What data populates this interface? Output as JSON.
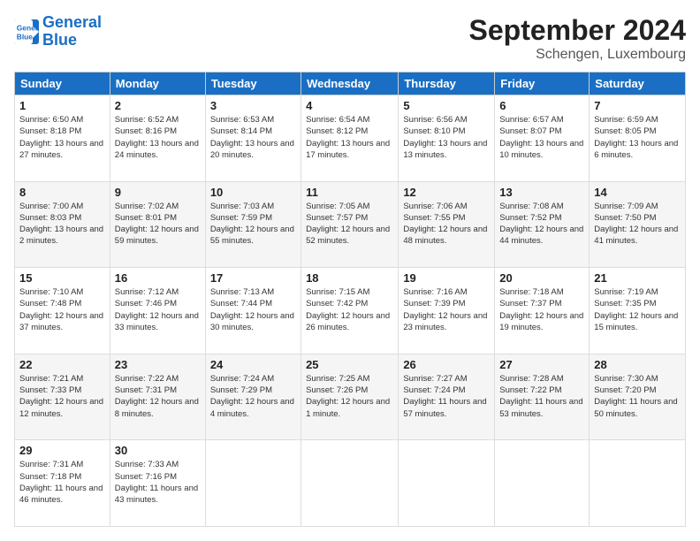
{
  "logo": {
    "line1": "General",
    "line2": "Blue"
  },
  "title": "September 2024",
  "location": "Schengen, Luxembourg",
  "days_header": [
    "Sunday",
    "Monday",
    "Tuesday",
    "Wednesday",
    "Thursday",
    "Friday",
    "Saturday"
  ],
  "weeks": [
    [
      {
        "day": "1",
        "sunrise": "6:50 AM",
        "sunset": "8:18 PM",
        "daylight": "13 hours and 27 minutes."
      },
      {
        "day": "2",
        "sunrise": "6:52 AM",
        "sunset": "8:16 PM",
        "daylight": "13 hours and 24 minutes."
      },
      {
        "day": "3",
        "sunrise": "6:53 AM",
        "sunset": "8:14 PM",
        "daylight": "13 hours and 20 minutes."
      },
      {
        "day": "4",
        "sunrise": "6:54 AM",
        "sunset": "8:12 PM",
        "daylight": "13 hours and 17 minutes."
      },
      {
        "day": "5",
        "sunrise": "6:56 AM",
        "sunset": "8:10 PM",
        "daylight": "13 hours and 13 minutes."
      },
      {
        "day": "6",
        "sunrise": "6:57 AM",
        "sunset": "8:07 PM",
        "daylight": "13 hours and 10 minutes."
      },
      {
        "day": "7",
        "sunrise": "6:59 AM",
        "sunset": "8:05 PM",
        "daylight": "13 hours and 6 minutes."
      }
    ],
    [
      {
        "day": "8",
        "sunrise": "7:00 AM",
        "sunset": "8:03 PM",
        "daylight": "13 hours and 2 minutes."
      },
      {
        "day": "9",
        "sunrise": "7:02 AM",
        "sunset": "8:01 PM",
        "daylight": "12 hours and 59 minutes."
      },
      {
        "day": "10",
        "sunrise": "7:03 AM",
        "sunset": "7:59 PM",
        "daylight": "12 hours and 55 minutes."
      },
      {
        "day": "11",
        "sunrise": "7:05 AM",
        "sunset": "7:57 PM",
        "daylight": "12 hours and 52 minutes."
      },
      {
        "day": "12",
        "sunrise": "7:06 AM",
        "sunset": "7:55 PM",
        "daylight": "12 hours and 48 minutes."
      },
      {
        "day": "13",
        "sunrise": "7:08 AM",
        "sunset": "7:52 PM",
        "daylight": "12 hours and 44 minutes."
      },
      {
        "day": "14",
        "sunrise": "7:09 AM",
        "sunset": "7:50 PM",
        "daylight": "12 hours and 41 minutes."
      }
    ],
    [
      {
        "day": "15",
        "sunrise": "7:10 AM",
        "sunset": "7:48 PM",
        "daylight": "12 hours and 37 minutes."
      },
      {
        "day": "16",
        "sunrise": "7:12 AM",
        "sunset": "7:46 PM",
        "daylight": "12 hours and 33 minutes."
      },
      {
        "day": "17",
        "sunrise": "7:13 AM",
        "sunset": "7:44 PM",
        "daylight": "12 hours and 30 minutes."
      },
      {
        "day": "18",
        "sunrise": "7:15 AM",
        "sunset": "7:42 PM",
        "daylight": "12 hours and 26 minutes."
      },
      {
        "day": "19",
        "sunrise": "7:16 AM",
        "sunset": "7:39 PM",
        "daylight": "12 hours and 23 minutes."
      },
      {
        "day": "20",
        "sunrise": "7:18 AM",
        "sunset": "7:37 PM",
        "daylight": "12 hours and 19 minutes."
      },
      {
        "day": "21",
        "sunrise": "7:19 AM",
        "sunset": "7:35 PM",
        "daylight": "12 hours and 15 minutes."
      }
    ],
    [
      {
        "day": "22",
        "sunrise": "7:21 AM",
        "sunset": "7:33 PM",
        "daylight": "12 hours and 12 minutes."
      },
      {
        "day": "23",
        "sunrise": "7:22 AM",
        "sunset": "7:31 PM",
        "daylight": "12 hours and 8 minutes."
      },
      {
        "day": "24",
        "sunrise": "7:24 AM",
        "sunset": "7:29 PM",
        "daylight": "12 hours and 4 minutes."
      },
      {
        "day": "25",
        "sunrise": "7:25 AM",
        "sunset": "7:26 PM",
        "daylight": "12 hours and 1 minute."
      },
      {
        "day": "26",
        "sunrise": "7:27 AM",
        "sunset": "7:24 PM",
        "daylight": "11 hours and 57 minutes."
      },
      {
        "day": "27",
        "sunrise": "7:28 AM",
        "sunset": "7:22 PM",
        "daylight": "11 hours and 53 minutes."
      },
      {
        "day": "28",
        "sunrise": "7:30 AM",
        "sunset": "7:20 PM",
        "daylight": "11 hours and 50 minutes."
      }
    ],
    [
      {
        "day": "29",
        "sunrise": "7:31 AM",
        "sunset": "7:18 PM",
        "daylight": "11 hours and 46 minutes."
      },
      {
        "day": "30",
        "sunrise": "7:33 AM",
        "sunset": "7:16 PM",
        "daylight": "11 hours and 43 minutes."
      },
      null,
      null,
      null,
      null,
      null
    ]
  ]
}
